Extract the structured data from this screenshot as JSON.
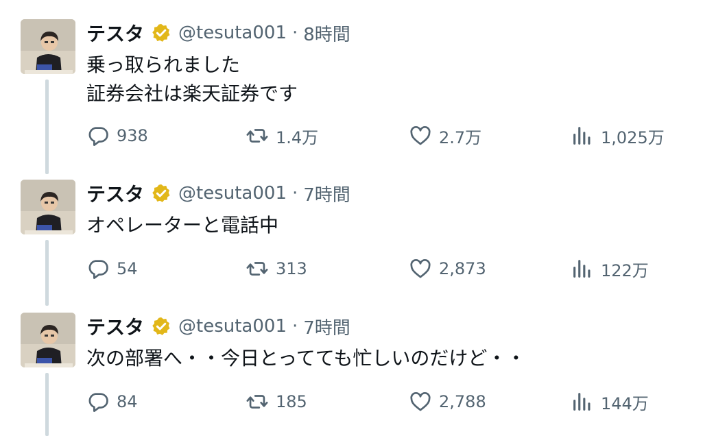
{
  "tweets": [
    {
      "name": "テスタ",
      "handle": "@tesuta001",
      "separator": "·",
      "time": "8時間",
      "lines": [
        "乗っ取られました",
        "証券会社は楽天証券です"
      ],
      "replies": "938",
      "retweets": "1.4万",
      "likes": "2.7万",
      "views": "1,025万"
    },
    {
      "name": "テスタ",
      "handle": "@tesuta001",
      "separator": "·",
      "time": "7時間",
      "lines": [
        "オペレーターと電話中"
      ],
      "replies": "54",
      "retweets": "313",
      "likes": "2,873",
      "views": "122万"
    },
    {
      "name": "テスタ",
      "handle": "@tesuta001",
      "separator": "·",
      "time": "7時間",
      "lines": [
        "次の部署へ・・今日とってても忙しいのだけど・・"
      ],
      "replies": "84",
      "retweets": "185",
      "likes": "2,788",
      "views": "144万"
    }
  ],
  "icons": {
    "verified": "verified-badge-icon",
    "reply": "reply-icon",
    "retweet": "retweet-icon",
    "like": "heart-icon",
    "views": "views-bar-chart-icon"
  },
  "colors": {
    "verified_gold": "#e2b719",
    "thread_line": "#cfd9de",
    "secondary_text": "#536471"
  }
}
